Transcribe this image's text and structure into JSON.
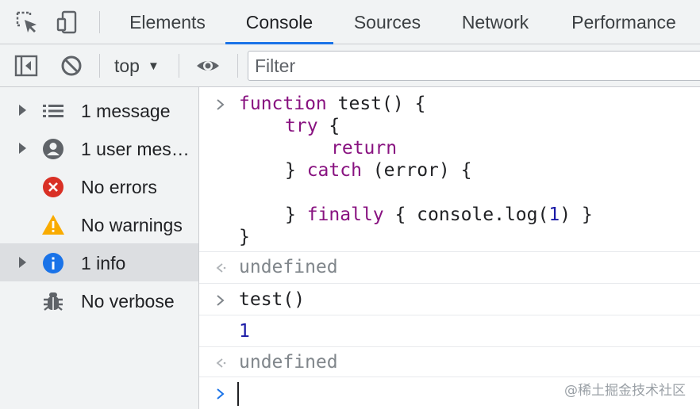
{
  "tabs": [
    {
      "label": "Elements"
    },
    {
      "label": "Console",
      "active": true
    },
    {
      "label": "Sources"
    },
    {
      "label": "Network"
    },
    {
      "label": "Performance"
    }
  ],
  "toolbar": {
    "context": "top",
    "filter_placeholder": "Filter"
  },
  "sidebar": {
    "items": [
      {
        "label": "1 message",
        "icon": "list-icon",
        "expandable": true
      },
      {
        "label": "1 user mes…",
        "icon": "user-icon",
        "expandable": true
      },
      {
        "label": "No errors",
        "icon": "error-icon",
        "expandable": false
      },
      {
        "label": "No warnings",
        "icon": "warning-icon",
        "expandable": false
      },
      {
        "label": "1 info",
        "icon": "info-icon",
        "expandable": true,
        "selected": true
      },
      {
        "label": "No verbose",
        "icon": "bug-icon",
        "expandable": false
      }
    ]
  },
  "console": {
    "code": {
      "l1a": "function",
      "l1b": " test() {",
      "l2a": "try",
      "l2b": " {",
      "l3": "return",
      "l4a": "} ",
      "l4b": "catch",
      "l4c": " (error) {",
      "l6a": "} ",
      "l6b": "finally",
      "l6c": " { console.log(",
      "l6d": "1",
      "l6e": ") }",
      "l7": "}"
    },
    "result1": "undefined",
    "input2": "test()",
    "log_output": "1",
    "result2": "undefined"
  },
  "watermark": "@稀土掘金技术社区",
  "colors": {
    "accent": "#1a73e8",
    "keyword": "#881280",
    "number": "#1a1aa6",
    "error": "#d93025",
    "warning": "#f9ab00",
    "info": "#1a73e8"
  }
}
